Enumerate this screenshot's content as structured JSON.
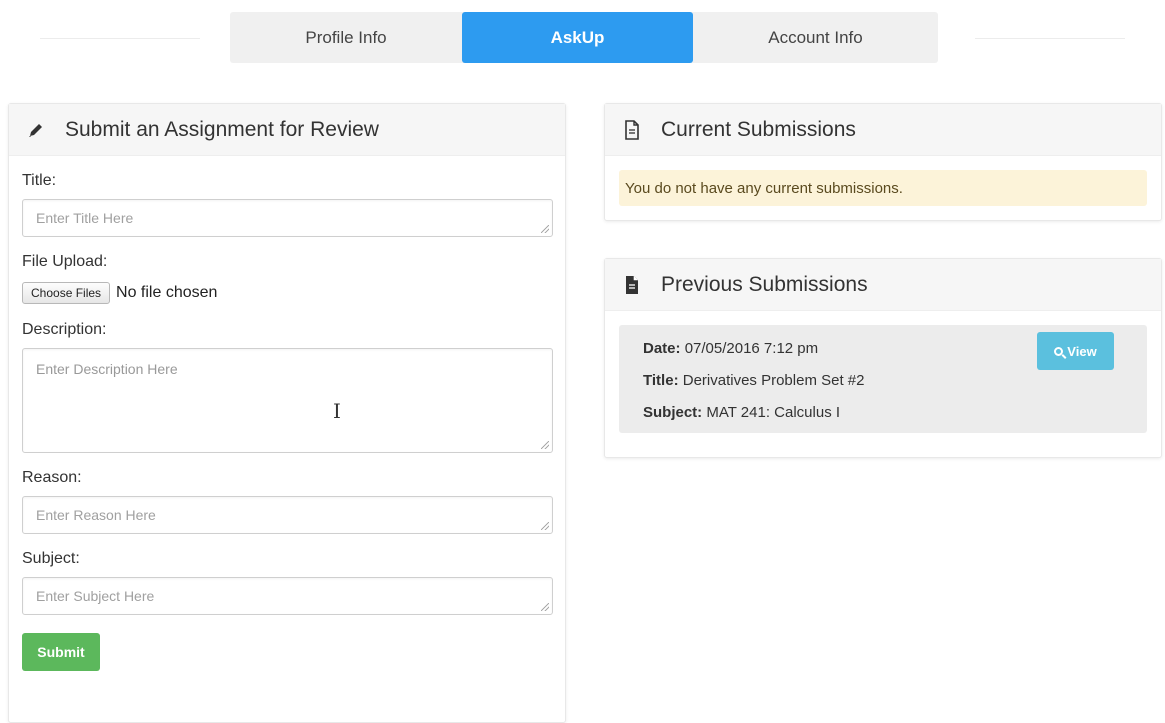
{
  "tabs": [
    {
      "label": "Profile Info",
      "active": false
    },
    {
      "label": "AskUp",
      "active": true
    },
    {
      "label": "Account Info",
      "active": false
    }
  ],
  "submit_panel": {
    "icon": "pencil-icon",
    "title": "Submit an Assignment for Review",
    "title_field": {
      "label": "Title:",
      "placeholder": "Enter Title Here"
    },
    "file_field": {
      "label": "File Upload:",
      "button": "Choose Files",
      "status": "No file chosen"
    },
    "description_field": {
      "label": "Description:",
      "placeholder": "Enter Description Here"
    },
    "reason_field": {
      "label": "Reason:",
      "placeholder": "Enter Reason Here"
    },
    "subject_field": {
      "label": "Subject:",
      "placeholder": "Enter Subject Here"
    },
    "submit_label": "Submit"
  },
  "current_panel": {
    "icon": "document-outline-icon",
    "title": "Current Submissions",
    "empty_message": "You do not have any current submissions."
  },
  "previous_panel": {
    "icon": "document-filled-icon",
    "title": "Previous Submissions",
    "items": [
      {
        "date_label": "Date:",
        "date": "07/05/2016 7:12 pm",
        "title_label": "Title:",
        "title": "Derivatives Problem Set #2",
        "subject_label": "Subject:",
        "subject": "MAT 241: Calculus I",
        "view_label": "View"
      }
    ]
  },
  "colors": {
    "active_tab": "#2d9bf0",
    "submit_button": "#5cb85c",
    "view_button": "#5bc0de",
    "alert_background": "#fcf3d9"
  }
}
